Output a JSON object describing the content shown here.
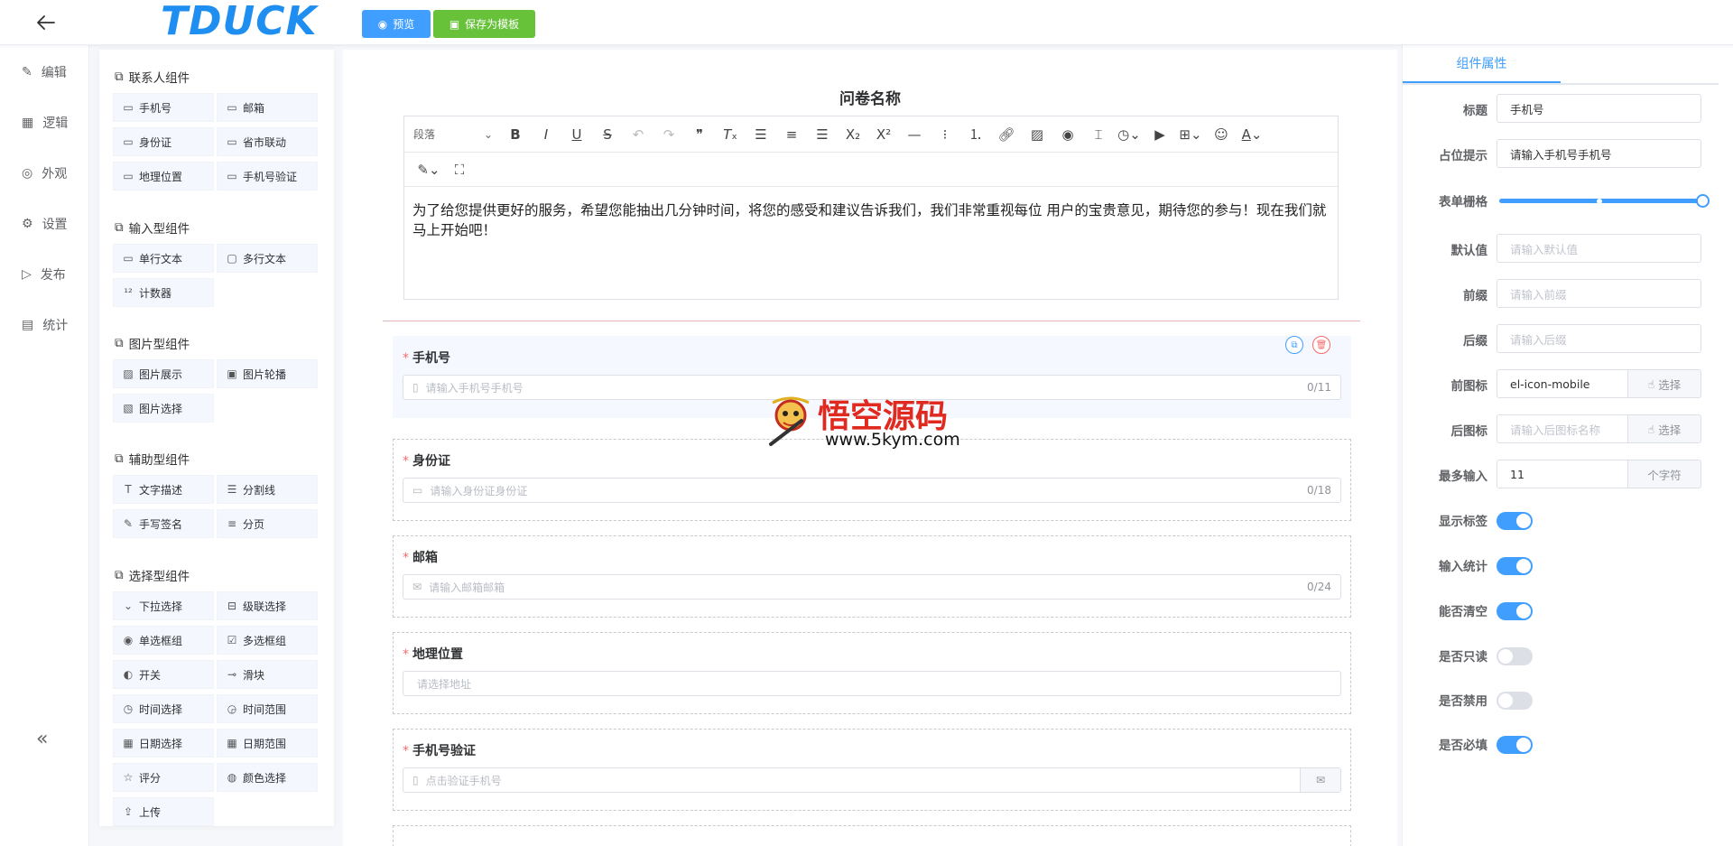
{
  "header": {
    "logo": "TDUCK",
    "preview_label": "预览",
    "save_template_label": "保存为模板"
  },
  "nav": {
    "items": [
      "编辑",
      "逻辑",
      "外观",
      "设置",
      "发布",
      "统计"
    ],
    "collapse": "«"
  },
  "palette": {
    "groups": [
      {
        "title": "联系人组件",
        "items": [
          "手机号",
          "邮箱",
          "身份证",
          "省市联动",
          "地理位置",
          "手机号验证"
        ]
      },
      {
        "title": "输入型组件",
        "items": [
          "单行文本",
          "多行文本",
          "计数器"
        ]
      },
      {
        "title": "图片型组件",
        "items": [
          "图片展示",
          "图片轮播",
          "图片选择"
        ]
      },
      {
        "title": "辅助型组件",
        "items": [
          "文字描述",
          "分割线",
          "手写签名",
          "分页"
        ]
      },
      {
        "title": "选择型组件",
        "items": [
          "下拉选择",
          "级联选择",
          "单选框组",
          "多选框组",
          "开关",
          "滑块",
          "时间选择",
          "时间范围",
          "日期选择",
          "日期范围",
          "评分",
          "颜色选择",
          "上传"
        ]
      }
    ]
  },
  "form": {
    "title": "问卷名称",
    "paragraph_select": "段落",
    "description": "为了给您提供更好的服务，希望您能抽出几分钟时间，将您的感受和建议告诉我们，我们非常重视每位 用户的宝贵意见，期待您的参与！现在我们就马上开始吧！",
    "fields": [
      {
        "label": "手机号",
        "placeholder": "请输入手机号手机号",
        "count": "0/11"
      },
      {
        "label": "身份证",
        "placeholder": "请输入身份证身份证",
        "count": "0/18"
      },
      {
        "label": "邮箱",
        "placeholder": "请输入邮箱邮箱",
        "count": "0/24"
      },
      {
        "label": "地理位置",
        "placeholder": "请选择地址",
        "count": ""
      },
      {
        "label": "手机号验证",
        "placeholder": "点击验证手机号",
        "count": ""
      }
    ]
  },
  "watermark": {
    "title": "悟空源码",
    "url": "www.5kym.com"
  },
  "props": {
    "tab": "组件属性",
    "title_label": "标题",
    "title_value": "手机号",
    "placeholder_label": "占位提示",
    "placeholder_value": "请输入手机号手机号",
    "grid_label": "表单栅格",
    "grid_value": 24,
    "default_label": "默认值",
    "default_placeholder": "请输入默认值",
    "prefix_label": "前缀",
    "prefix_placeholder": "请输入前缀",
    "suffix_label": "后缀",
    "suffix_placeholder": "请输入后缀",
    "prefix_icon_label": "前图标",
    "prefix_icon_value": "el-icon-mobile",
    "choose_label": "选择",
    "suffix_icon_label": "后图标",
    "suffix_icon_placeholder": "请输入后图标名称",
    "maxlength_label": "最多输入",
    "maxlength_value": "11",
    "maxlength_unit": "个字符",
    "switches": [
      {
        "label": "显示标签",
        "on": true
      },
      {
        "label": "输入统计",
        "on": true
      },
      {
        "label": "能否清空",
        "on": true
      },
      {
        "label": "是否只读",
        "on": false
      },
      {
        "label": "是否禁用",
        "on": false
      },
      {
        "label": "是否必填",
        "on": true
      }
    ]
  },
  "colors": {
    "primary": "#409eff",
    "success": "#67c23a",
    "danger": "#f56c6c",
    "watermark_red": "#e02a20"
  }
}
